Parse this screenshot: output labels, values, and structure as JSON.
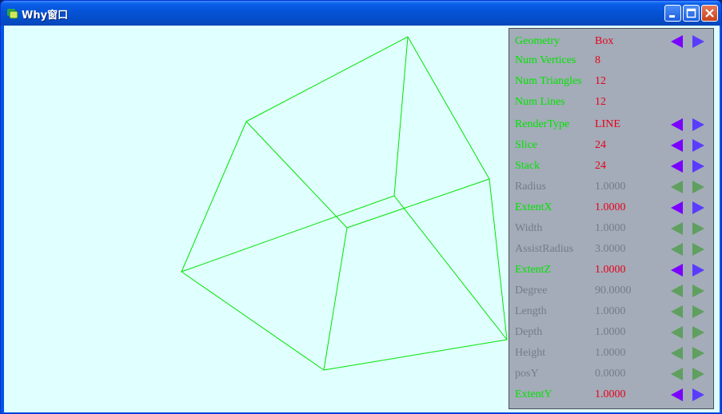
{
  "window": {
    "title": "Why窗口",
    "minimize_icon": "minimize-icon",
    "maximize_icon": "maximize-icon",
    "close_icon": "close-icon"
  },
  "colors": {
    "background": "#e0ffff",
    "wireframe": "#00e400",
    "active_label": "#00e400",
    "active_value": "#e8001c",
    "inactive_text": "#737c88",
    "active_arrow": "#7a00ff",
    "active_arrow_right": "#5a3cff",
    "inactive_arrow": "#5f9f5f",
    "panel_background": "#a3acb8"
  },
  "panel": {
    "rows": [
      {
        "label": "Geometry",
        "value": "Box",
        "state": "active",
        "arrows": true
      },
      {
        "label": "Num Vertices",
        "value": "8",
        "state": "active",
        "arrows": false
      },
      {
        "label": "Num Triangles",
        "value": "12",
        "state": "active",
        "arrows": false
      },
      {
        "label": "Num Lines",
        "value": "12",
        "state": "active",
        "arrows": false
      },
      {
        "label": "RenderType",
        "value": "LINE",
        "state": "active",
        "arrows": true
      },
      {
        "label": "Slice",
        "value": "24",
        "state": "active",
        "arrows": true
      },
      {
        "label": "Stack",
        "value": "24",
        "state": "active",
        "arrows": true
      },
      {
        "label": "Radius",
        "value": "1.0000",
        "state": "inactive",
        "arrows": true
      },
      {
        "label": "ExtentX",
        "value": "1.0000",
        "state": "active",
        "arrows": true
      },
      {
        "label": "Width",
        "value": "1.0000",
        "state": "inactive",
        "arrows": true
      },
      {
        "label": "AssistRadius",
        "value": "3.0000",
        "state": "inactive",
        "arrows": true
      },
      {
        "label": "ExtentZ",
        "value": "1.0000",
        "state": "active",
        "arrows": true
      },
      {
        "label": "Degree",
        "value": "90.0000",
        "state": "inactive",
        "arrows": true
      },
      {
        "label": "Length",
        "value": "1.0000",
        "state": "inactive",
        "arrows": true
      },
      {
        "label": "Depth",
        "value": "1.0000",
        "state": "inactive",
        "arrows": true
      },
      {
        "label": "Height",
        "value": "1.0000",
        "state": "inactive",
        "arrows": true
      },
      {
        "label": "posY",
        "value": "0.0000",
        "state": "inactive",
        "arrows": true
      },
      {
        "label": "ExtentY",
        "value": "1.0000",
        "state": "active",
        "arrows": true
      }
    ]
  }
}
